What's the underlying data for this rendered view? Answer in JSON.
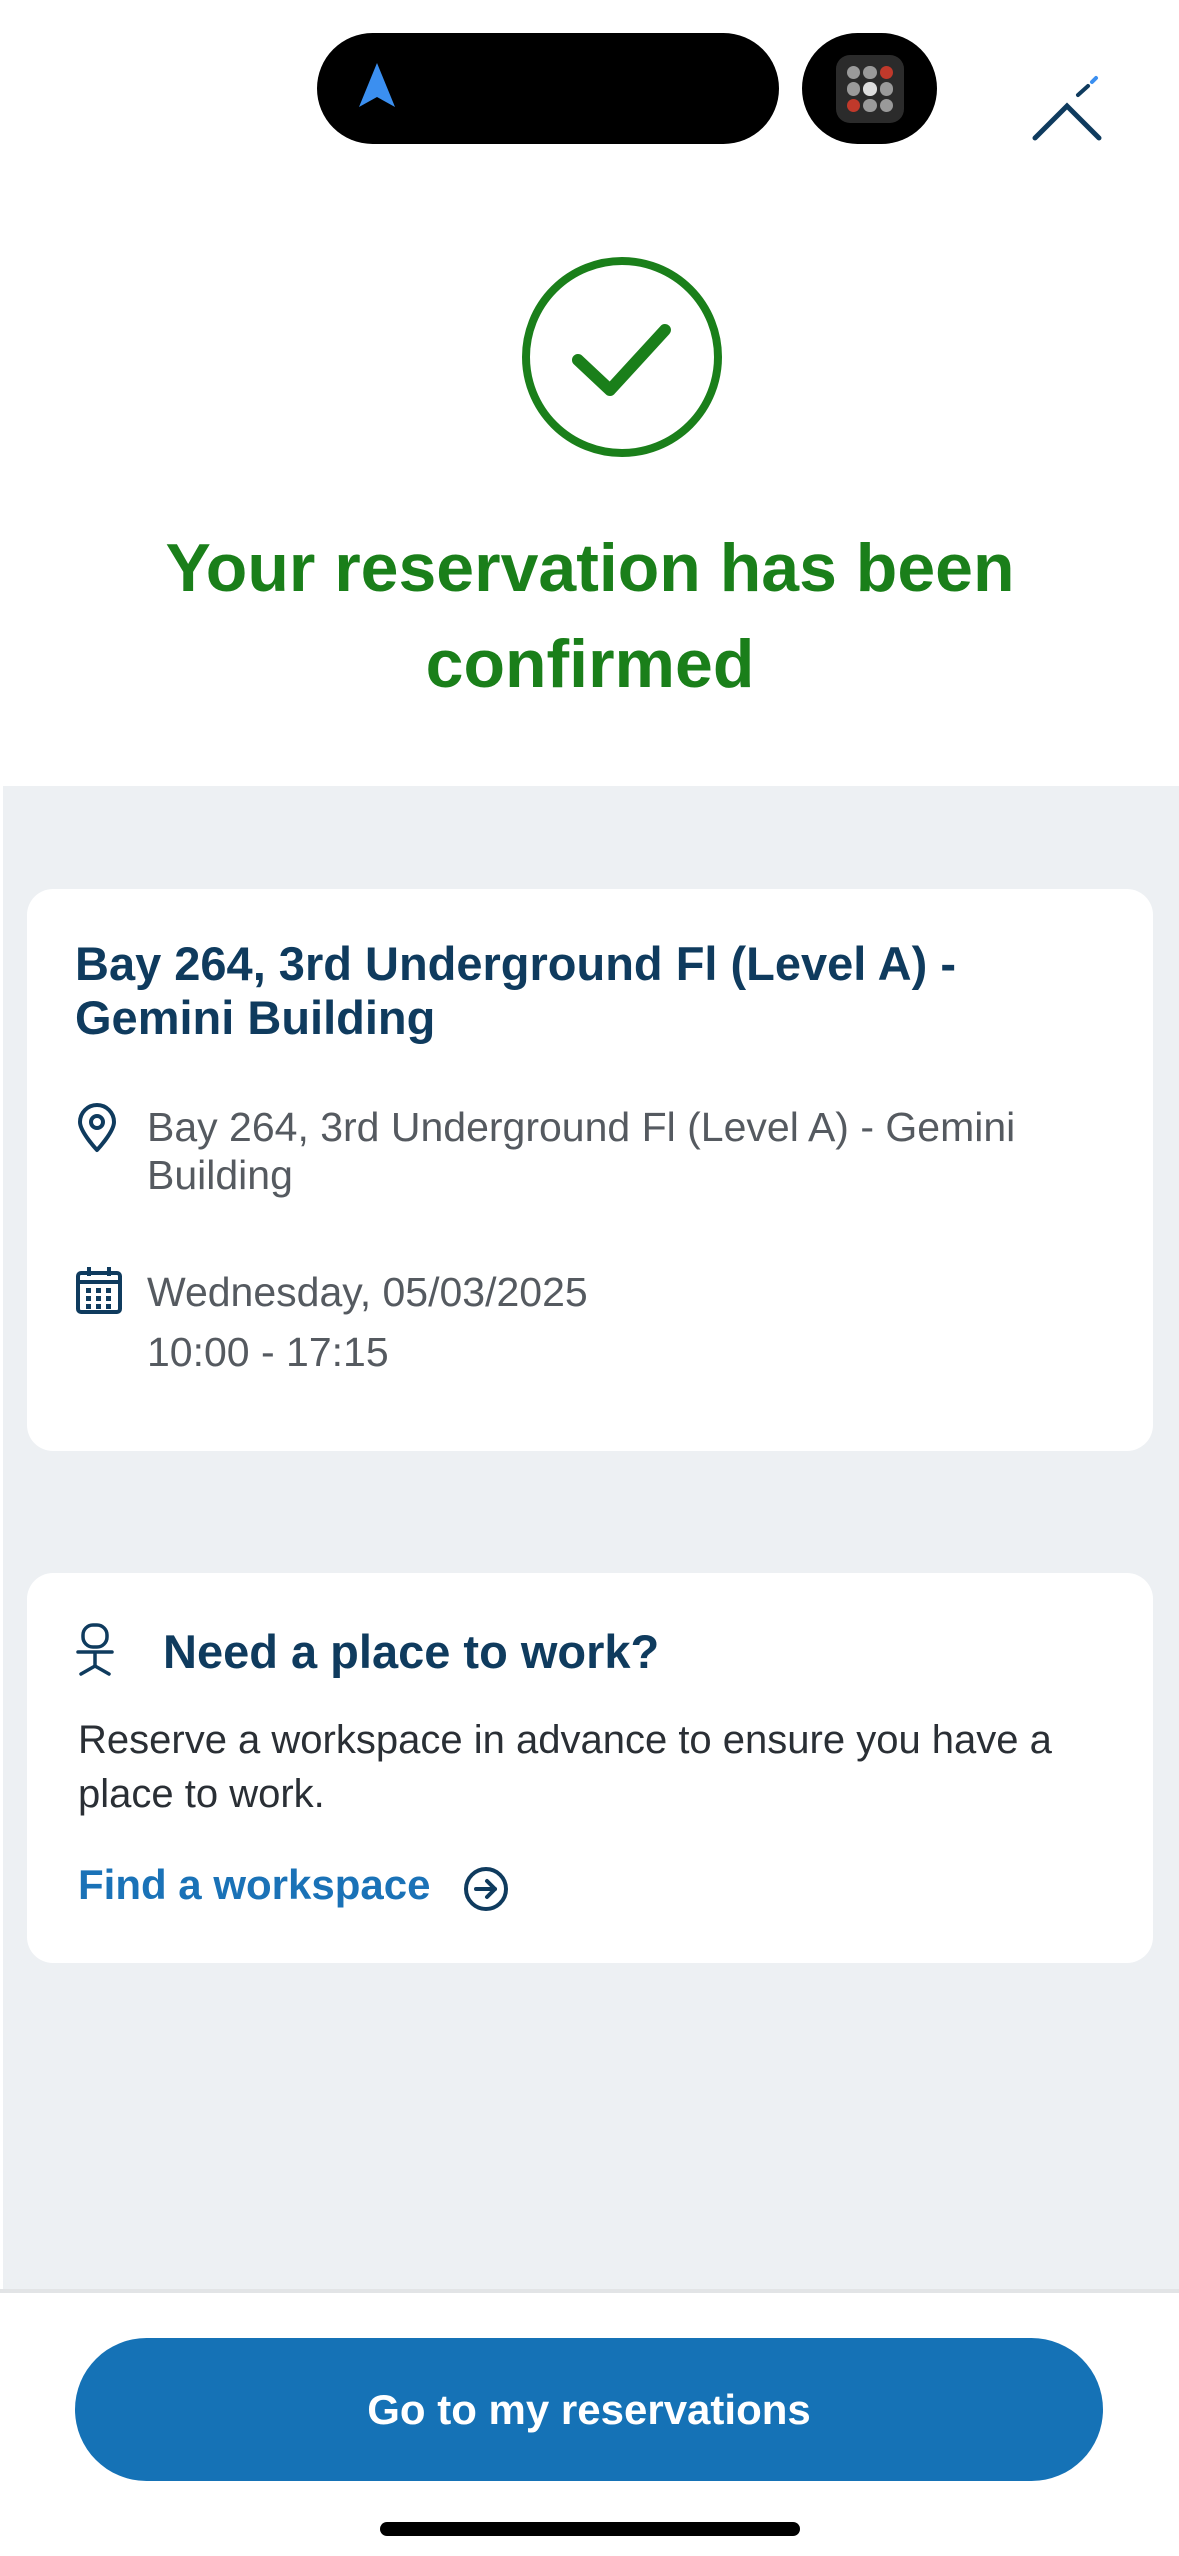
{
  "confirmation": {
    "title": "Your reservation has been confirmed"
  },
  "reservation": {
    "title": "Bay 264, 3rd Underground Fl (Level A) - Gemini Building",
    "location": "Bay 264, 3rd Underground Fl (Level A) - Gemini Building",
    "date": "Wednesday, 05/03/2025",
    "time": "10:00 - 17:15"
  },
  "workspace_promo": {
    "title": "Need a place to work?",
    "description": "Reserve a workspace in advance to ensure you have a place to work.",
    "link_label": "Find a workspace"
  },
  "footer": {
    "button_label": "Go to my reservations"
  },
  "icons": [
    "navigation-arrow-icon",
    "app-icon",
    "close-icon",
    "check-circle-icon",
    "location-pin-icon",
    "calendar-icon",
    "chair-icon",
    "arrow-circle-right-icon"
  ],
  "colors": {
    "success": "#1a7f1a",
    "primary": "#1572b6",
    "heading": "#0f3b5e",
    "background": "#edf0f3"
  }
}
